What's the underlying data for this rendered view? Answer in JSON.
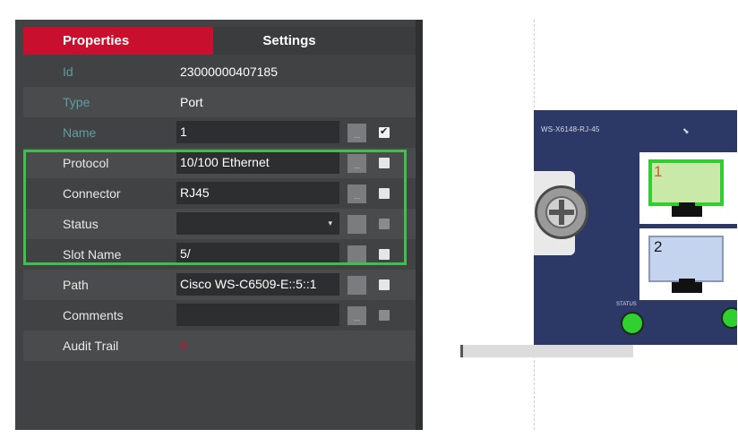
{
  "tabs": {
    "properties": "Properties",
    "settings": "Settings"
  },
  "fields": {
    "id": {
      "label": "Id",
      "value": "23000000407185"
    },
    "type": {
      "label": "Type",
      "value": "Port"
    },
    "name": {
      "label": "Name",
      "value": "1",
      "checked": true
    },
    "protocol": {
      "label": "Protocol",
      "value": "10/100 Ethernet",
      "checked": false
    },
    "connector": {
      "label": "Connector",
      "value": "RJ45",
      "checked": false
    },
    "status": {
      "label": "Status",
      "value": "",
      "checked": false
    },
    "slot_name": {
      "label": "Slot Name",
      "value": "5/",
      "checked": false
    },
    "path": {
      "label": "Path",
      "value": "Cisco WS-C6509-E::5::1",
      "checked": false
    },
    "comments": {
      "label": "Comments",
      "value": "",
      "checked": false
    },
    "audit_trail": {
      "label": "Audit Trail",
      "value": "0"
    }
  },
  "ellipsis": "...",
  "dropdown_arrow": "▾",
  "device": {
    "label": "WS-X6148-RJ-45",
    "status_label": "STATUS",
    "ports": [
      {
        "label": "1"
      },
      {
        "label": "2"
      }
    ]
  },
  "colors": {
    "accent": "#c8102e",
    "highlight": "#3ec04a",
    "device": "#2c3866",
    "led": "#2fd02f"
  }
}
